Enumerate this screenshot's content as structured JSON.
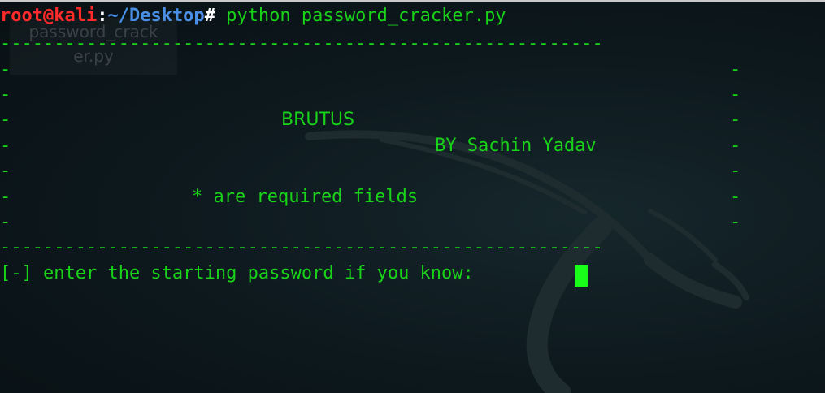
{
  "prompt": {
    "user_host": "root@kali",
    "separator": ":",
    "path": "~/Desktop",
    "hash": "#",
    "command": " python password_cracker.py"
  },
  "desktop_icon": {
    "label_line1": "password_crack",
    "label_line2": "er.py"
  },
  "banner": {
    "border": "--------------------------------------------------------",
    "side": "-",
    "title": "BRUTUS",
    "author": "BY Sachin Yadav",
    "note": "* are required fields"
  },
  "input_prompt": "[-] enter the starting password if you know: ",
  "colors": {
    "text_green": "#19d319",
    "user_red": "#ff2a2a",
    "path_blue": "#4a8fe6",
    "cursor_green": "#19ff19"
  },
  "icons": {
    "background_logo": "kali-dragon-icon"
  }
}
